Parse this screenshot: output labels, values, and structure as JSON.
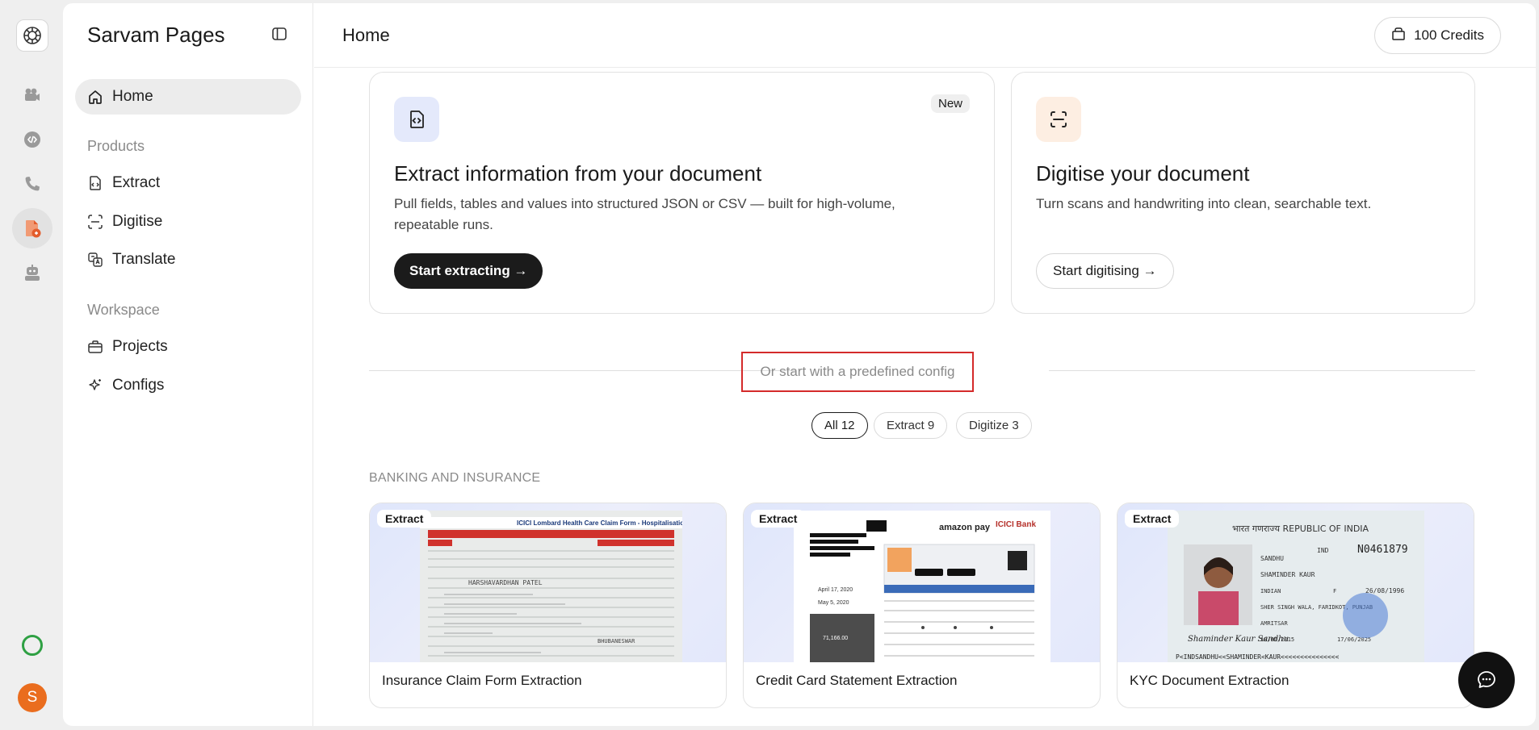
{
  "rail": {
    "items": [
      {
        "icon": "video-camera-icon"
      },
      {
        "icon": "code-icon"
      },
      {
        "icon": "phone-icon"
      },
      {
        "icon": "document-icon"
      },
      {
        "icon": "robot-icon"
      }
    ],
    "avatar_initial": "S",
    "colors": {
      "status": "#2ea043",
      "avatar": "#ea6d1e"
    }
  },
  "sidebar": {
    "brand": "Sarvam Pages",
    "home": "Home",
    "products_label": "Products",
    "products": [
      "Extract",
      "Digitise",
      "Translate"
    ],
    "workspace_label": "Workspace",
    "workspace": [
      "Projects",
      "Configs"
    ]
  },
  "header": {
    "title": "Home",
    "credits": "100 Credits"
  },
  "cards": {
    "extract": {
      "badge": "New",
      "title": "Extract information from your document",
      "desc_line1": "Pull fields, tables and values into structured JSON or CSV — built for high-volume,",
      "desc_line2": "repeatable runs.",
      "button": "Start extracting →"
    },
    "digitise": {
      "title": "Digitise your document",
      "desc": "Turn scans and handwriting into clean, searchable text.",
      "button": "Start digitising →"
    }
  },
  "divider": {
    "label": "Or start with a predefined config"
  },
  "filters": [
    "All 12",
    "Extract 9",
    "Digitize 3"
  ],
  "section": "BANKING AND INSURANCE",
  "configs": [
    {
      "tag": "Extract",
      "title": "Insurance Claim Form Extraction"
    },
    {
      "tag": "Extract",
      "title": "Credit Card Statement Extraction"
    },
    {
      "tag": "Extract",
      "title": "KYC Document Extraction"
    }
  ],
  "thumbs": {
    "claim": {
      "header": "ICICI Lombard Health Care Claim Form - Hospitalisation",
      "name": "HARSHAVARDHAN PATEL",
      "place": "BHUBANESWAR"
    },
    "statement": {
      "brand1": "amazon pay",
      "brand2": "ICICI Bank",
      "date1": "April 17, 2020",
      "date2": "May 5, 2020",
      "amount": "71,166.00"
    },
    "passport": {
      "header": "भारत गणराज्य REPUBLIC OF INDIA",
      "number": "N0461879",
      "code": "IND",
      "surname": "SANDHU",
      "given": "SHAMINDER KAUR",
      "nationality": "INDIAN",
      "sex": "F",
      "dob": "26/08/1996",
      "pob": "SHER SINGH WALA, FARIDKOT, PUNJAB",
      "poi": "AMRITSAR",
      "doi": "18/06/2015",
      "doe": "17/06/2025",
      "signature": "Shaminder Kaur Sandhu",
      "mrz": "P<INDSANDHU<<SHAMINDER<KAUR<<<<<<<<<<<<<<<"
    }
  },
  "chat": {
    "icon": "chat-bubble-icon"
  }
}
